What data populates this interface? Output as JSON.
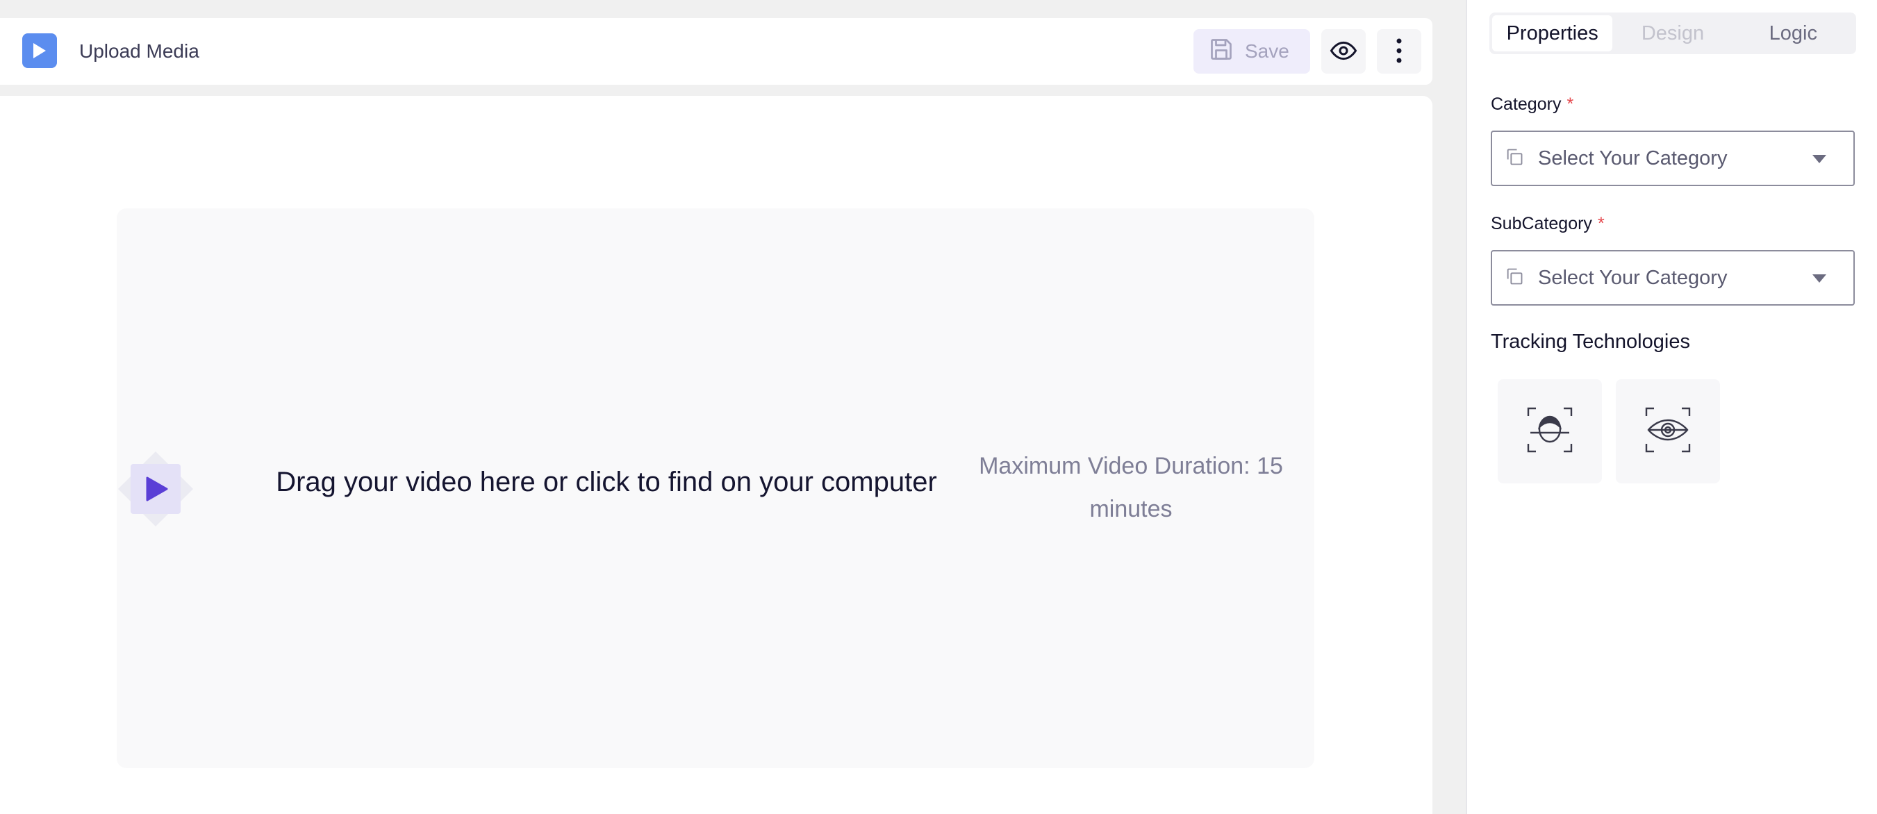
{
  "header": {
    "title": "Upload Media",
    "save_label": "Save",
    "icons": {
      "logo": "play-icon",
      "save": "floppy-disk-icon",
      "preview": "eye-icon",
      "more": "more-vertical-icon"
    }
  },
  "dropzone": {
    "prompt": "Drag your video here or click to find on your computer",
    "duration_note": "Maximum Video Duration: 15 minutes",
    "icon": "video-play-icon"
  },
  "panel": {
    "tabs": [
      {
        "label": "Properties",
        "active": true
      },
      {
        "label": "Design",
        "disabled": true
      },
      {
        "label": "Logic"
      }
    ],
    "category": {
      "label": "Category",
      "required_mark": "*",
      "value": "Select Your Category"
    },
    "subcategory": {
      "label": "SubCategory",
      "required_mark": "*",
      "value": "Select Your Category"
    },
    "tracking": {
      "title": "Tracking Technologies",
      "options": [
        {
          "icon": "face-scan-icon"
        },
        {
          "icon": "eye-tracking-icon"
        }
      ]
    }
  },
  "colors": {
    "accent": "#5b8def",
    "purple": "#5a3fd6",
    "required": "#e5484d"
  }
}
